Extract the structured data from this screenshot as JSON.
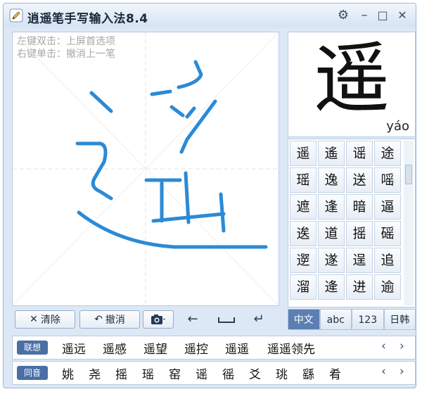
{
  "window": {
    "title": "逍遥笔手写输入法8.4",
    "controls": {
      "settings": "⚙",
      "minimize": "–",
      "maximize": "□",
      "close": "✕"
    }
  },
  "canvas": {
    "hint_line1": "左键双击：上屏首选项",
    "hint_line2": "右键单击：撤消上一笔",
    "stroke_color": "#2b8ad6"
  },
  "toolbar": {
    "clear_label": "清除",
    "undo_label": "撤消"
  },
  "preview": {
    "character": "遥",
    "pinyin": "yáo"
  },
  "candidates": [
    [
      "遥",
      "遙",
      "谣",
      "途"
    ],
    [
      "瑶",
      "逸",
      "送",
      "嗂"
    ],
    [
      "遮",
      "逢",
      "暗",
      "逼"
    ],
    [
      "逘",
      "道",
      "摇",
      "磘"
    ],
    [
      "遻",
      "遂",
      "逞",
      "追"
    ],
    [
      "溜",
      "逄",
      "进",
      "逾"
    ]
  ],
  "modes": [
    {
      "label": "中文",
      "active": true
    },
    {
      "label": "abc",
      "active": false
    },
    {
      "label": "123",
      "active": false
    },
    {
      "label": "日韩",
      "active": false
    }
  ],
  "association": {
    "label": "联想",
    "items": [
      "遥远",
      "遥感",
      "遥望",
      "遥控",
      "遥遥",
      "遥遥领先"
    ]
  },
  "homophones": {
    "label": "同音",
    "items": [
      "姚",
      "尧",
      "摇",
      "瑶",
      "窑",
      "谣",
      "徭",
      "爻",
      "珧",
      "繇",
      "肴"
    ]
  },
  "nav": {
    "prev": "‹",
    "next": "›"
  }
}
